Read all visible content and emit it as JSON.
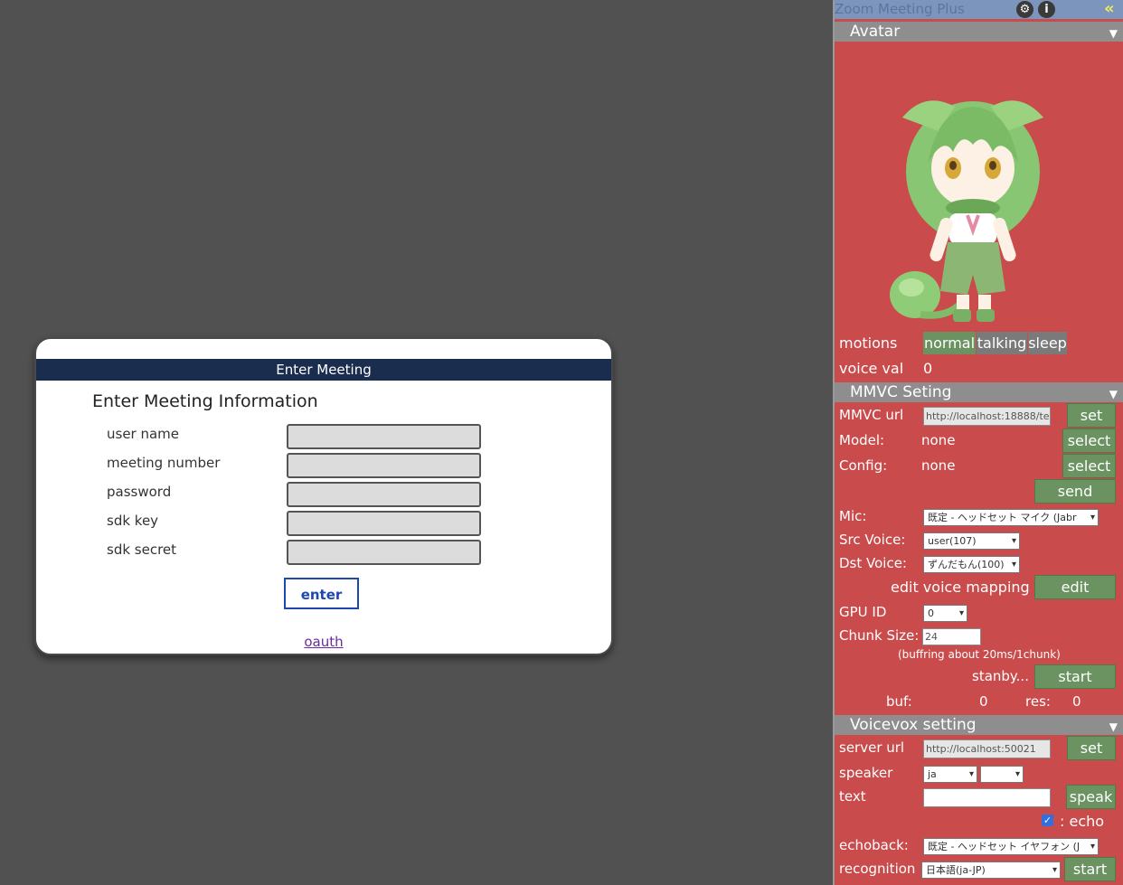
{
  "dialog": {
    "title": "Enter Meeting",
    "heading": "Enter Meeting Information",
    "fields": [
      "user name",
      "meeting number",
      "password",
      "sdk key",
      "sdk secret"
    ],
    "enter_label": "enter",
    "oauth_label": "oauth"
  },
  "panel": {
    "title": "Zoom Meeting Plus",
    "gear_icon": "gear-icon",
    "info_icon": "i",
    "collapse_icon": "«",
    "avatar": {
      "header": "Avatar",
      "motions_label": "motions",
      "motions": [
        "normal",
        "talking",
        "sleep"
      ],
      "voice_val_label": "voice val",
      "voice_val": "0"
    },
    "mmvc": {
      "header": "MMVC Seting",
      "url_label": "MMVC url",
      "url_value": "http://localhost:18888/te",
      "set_label": "set",
      "model_label": "Model:",
      "model_value": "none",
      "config_label": "Config:",
      "config_value": "none",
      "select_label": "select",
      "send_label": "send",
      "mic_label": "Mic:",
      "mic_value": "既定 - ヘッドセット マイク (Jabr",
      "src_label": "Src Voice:",
      "src_value": "user(107)",
      "dst_label": "Dst Voice:",
      "dst_value": "ずんだもん(100)",
      "edit_mapping_label": "edit voice mapping",
      "edit_label": "edit",
      "gpu_label": "GPU ID",
      "gpu_value": "0",
      "chunk_label": "Chunk Size:",
      "chunk_value": "24",
      "chunk_note": "(buffring about 20ms/1chunk)",
      "status": "stanby...",
      "start_label": "start",
      "buf_label": "buf:",
      "buf_value": "0",
      "res_label": "res:",
      "res_value": "0"
    },
    "voicevox": {
      "header": "Voicevox setting",
      "server_label": "server url",
      "server_value": "http://localhost:50021",
      "set_label": "set",
      "speaker_label": "speaker",
      "speaker_lang": "ja",
      "text_label": "text",
      "speak_label": "speak",
      "echo_label": ": echo",
      "echoback_label": "echoback:",
      "echoback_value": "既定 - ヘッドセット イヤフォン (J",
      "recognition_label": "recognition",
      "recognition_value": "日本語(ja-JP)",
      "start_label": "start"
    }
  },
  "colors": {
    "background": "#515151",
    "panel": "#c94b4b",
    "button": "#6b9361",
    "dialog_title": "#1b2d4f"
  }
}
